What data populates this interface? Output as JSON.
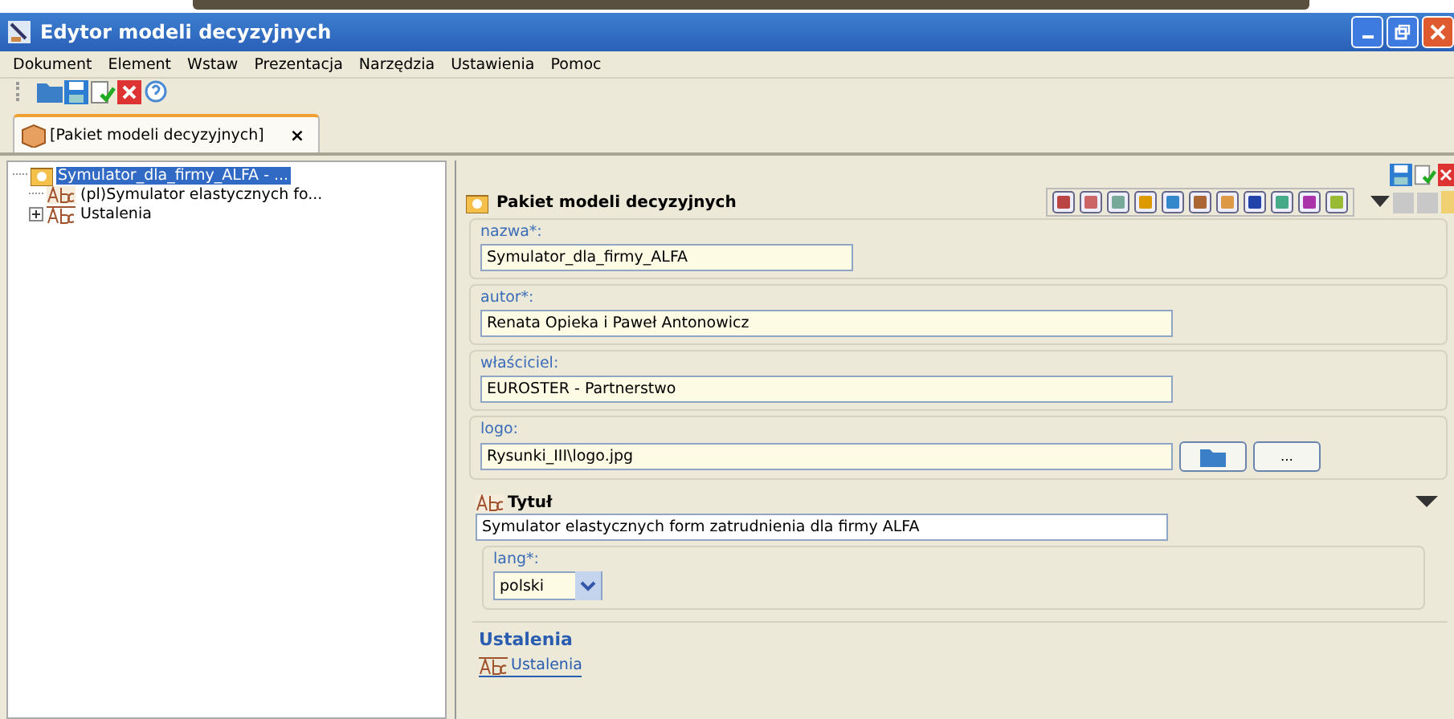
{
  "window": {
    "title": "Edytor modeli decyzyjnych"
  },
  "menu": [
    "Dokument",
    "Element",
    "Wstaw",
    "Prezentacja",
    "Narzędzia",
    "Ustawienia",
    "Pomoc"
  ],
  "tabs": [
    {
      "label": "[Pakiet modeli decyzyjnych]",
      "selected": true,
      "close": "×"
    }
  ],
  "tree": [
    {
      "label": "Symulator_dla_firmy_ALFA - ...",
      "kind": "package",
      "selected": true,
      "expanded": true,
      "children": [
        {
          "label": "(pl)Symulator elastycznych fo...",
          "kind": "text",
          "selected": false
        },
        {
          "label": "Ustalenia",
          "kind": "settings",
          "selected": false,
          "expanded": false
        }
      ]
    }
  ],
  "editor": {
    "title": "Pakiet modeli decyzyjnych",
    "fields": [
      {
        "label": "nazwa*:",
        "value": "Symulator_dla_firmy_ALFA",
        "kind": "short"
      },
      {
        "label": "autor*:",
        "value": "Renata Opieka i Paweł Antonowicz",
        "kind": "long"
      },
      {
        "label": "właściciel:",
        "value": "EUROSTER - Partnerstwo",
        "kind": "long"
      },
      {
        "label": "logo:",
        "value": "Rysunki_III\\logo.jpg",
        "kind": "file",
        "browse": "..."
      }
    ],
    "title_section": {
      "heading": "Tytuł",
      "value": "Symulator elastycznych form zatrudnienia dla firmy ALFA",
      "lang_label": "lang*:",
      "lang": "polski"
    },
    "settings_section": {
      "heading": "Ustalenia",
      "link": "Ustalenia"
    }
  }
}
